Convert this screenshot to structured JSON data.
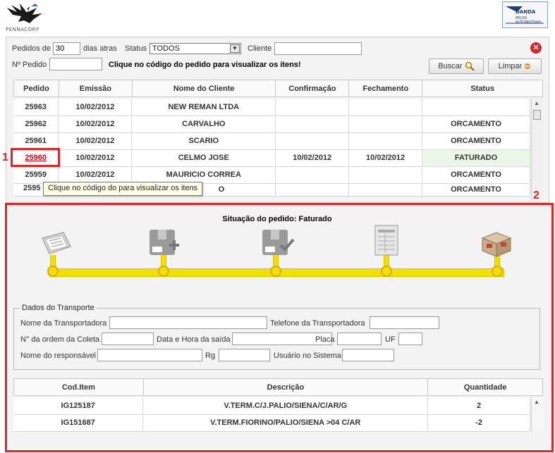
{
  "header": {
    "left_logo_text": "PENNACORP",
    "right_logo_title": "DANDA",
    "right_logo_subtitle": "PEÇAS AUTOMOTIVAS"
  },
  "filters": {
    "pedidos_de_label": "Pedidos de",
    "pedidos_de_value": "30",
    "dias_atras_label": "dias atras",
    "status_label": "Status",
    "status_value": "TODOS",
    "cliente_label": "Cliente",
    "cliente_value": "",
    "numero_pedido_label": "Nº Pedido",
    "numero_pedido_value": "",
    "hint": "Clique no código do pedido para visualizar os itens!",
    "buscar_label": "Buscar",
    "limpar_label": "Limpar"
  },
  "orders": {
    "columns": [
      "Pedido",
      "Emissão",
      "Nome do Cliente",
      "Confirmação",
      "Fechamento",
      "Status"
    ],
    "rows": [
      [
        "25963",
        "10/02/2012",
        "NEW REMAN LTDA",
        "",
        "",
        ""
      ],
      [
        "25962",
        "10/02/2012",
        "CARVALHO",
        "",
        "",
        "ORCAMENTO"
      ],
      [
        "25961",
        "10/02/2012",
        "SCARIO",
        "",
        "",
        "ORCAMENTO"
      ],
      [
        "25960",
        "10/02/2012",
        "CELMO JOSE",
        "10/02/2012",
        "10/02/2012",
        "FATURADO"
      ],
      [
        "25959",
        "10/02/2012",
        "MAURICIO CORREA",
        "",
        "",
        "ORCAMENTO"
      ],
      [
        "2595",
        "",
        "O",
        "",
        "",
        "ORCAMENTO"
      ]
    ]
  },
  "markers": {
    "one": "1",
    "two": "2"
  },
  "tooltip": "Clique no código do para visualizar os itens",
  "status_panel": {
    "title": "Situação do pedido: Faturado",
    "stage_icons": [
      "order-form-icon",
      "package-add-icon",
      "package-check-icon",
      "invoice-document-icon",
      "shipping-box-icon"
    ]
  },
  "transport": {
    "legend": "Dados do Transporte",
    "nome_transportadora_label": "Nome da Transportadora",
    "telefone_transportadora_label": "Telefone da Transportadora",
    "ordem_coleta_label": "N° da ordem da Coleta",
    "data_hora_saida_label": "Data e Hora da saída",
    "placa_label": "Placa",
    "uf_label": "UF",
    "nome_responsavel_label": "Nome do responsável",
    "rg_label": "Rg",
    "usuario_sistema_label": "Usuário no Sistema"
  },
  "items": {
    "columns": [
      "Cod.Item",
      "Descrição",
      "Quantidade"
    ],
    "rows": [
      [
        "IG125187",
        "V.TERM.C/J.PALIO/SIENA/C/AR/G",
        "2"
      ],
      [
        "IG151687",
        "V.TERM.FIORINO/PALIO/SIENA >04 C/AR",
        "-2"
      ]
    ]
  },
  "colors": {
    "highlight_red": "#d42a2a",
    "progress_yellow": "#f2e100",
    "faturado_bg": "#eaf7e6"
  }
}
